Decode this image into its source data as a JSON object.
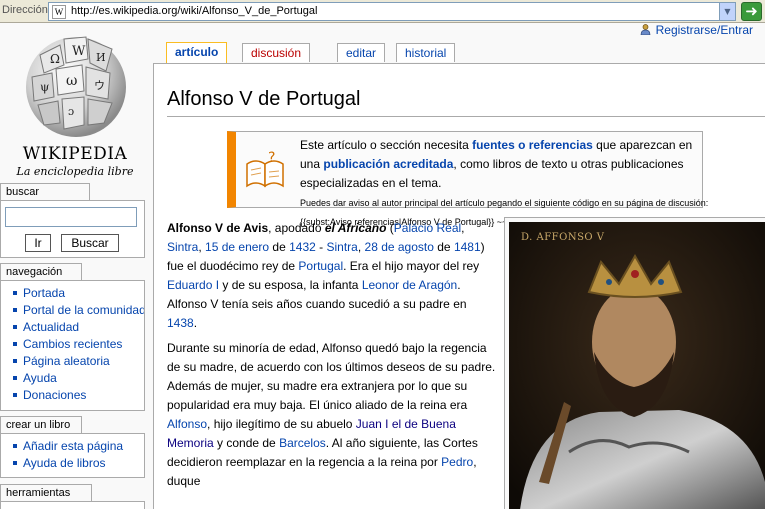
{
  "browser": {
    "address_label": "Dirección",
    "url": "http://es.wikipedia.org/wiki/Alfonso_V_de_Portugal",
    "go_icon": "green-arrow-icon"
  },
  "logo": {
    "wordmark": "WIKIPEDIA",
    "tagline": "La enciclopedia libre"
  },
  "personal": {
    "login": "Registrarse/Entrar"
  },
  "tabs": [
    {
      "label": "artículo"
    },
    {
      "label": "discusión"
    },
    {
      "label": "editar"
    },
    {
      "label": "historial"
    }
  ],
  "search": {
    "title": "buscar",
    "go": "Ir",
    "search": "Buscar"
  },
  "navigation": {
    "title": "navegación",
    "items": [
      "Portada",
      "Portal de la comunidad",
      "Actualidad",
      "Cambios recientes",
      "Página aleatoria",
      "Ayuda",
      "Donaciones"
    ]
  },
  "create_book": {
    "title": "crear un libro",
    "items": [
      "Añadir esta página",
      "Ayuda de libros"
    ]
  },
  "tools": {
    "title": "herramientas"
  },
  "article": {
    "title": "Alfonso V de Portugal",
    "notice": {
      "t1": "Este artículo o sección necesita ",
      "l1": "fuentes o referencias",
      "t2": " que aparezcan en una ",
      "l2": "publicación acreditada",
      "t3": ", como libros de texto u otras publicaciones especializadas en el tema.",
      "small": "Puedes dar aviso al autor principal del artículo pegando el siguiente código en su página de discusión: {{subst:Aviso referencias|Alfonso V de Portugal}} ~~~~"
    },
    "p1": {
      "a": "Alfonso V de Avis",
      "b": ", apodado ",
      "c": "el Africano",
      "d": " (",
      "e": "Palácio Real",
      "f": ", ",
      "g": "Sintra",
      "h": ", ",
      "i": "15 de enero",
      "j": " de ",
      "k": "1432",
      "l": " - ",
      "m": "Sintra",
      "n": ", ",
      "o": "28 de agosto",
      "p": " de ",
      "q": "1481",
      "r": ") fue el duodécimo rey de ",
      "s": "Portugal",
      "t": ". Era el hijo mayor del rey ",
      "u": "Eduardo I",
      "v": " y de su esposa, la infanta ",
      "w": "Leonor de Aragón",
      "x": ". Alfonso V tenía seis años cuando sucedió a su padre en ",
      "y": "1438",
      "z": "."
    },
    "p2": {
      "a": "Durante su minoría de edad, Alfonso quedó bajo la regencia de su madre, de acuerdo con los últimos deseos de su padre. Además de mujer, su madre era extranjera por lo que su popularidad era muy baja. El único aliado de la reina era ",
      "b": "Alfonso",
      "c": ", hijo ilegítimo de su abuelo ",
      "d": "Juan I el de Buena Memoria",
      "e": " y conde de ",
      "f": "Barcelos",
      "g": ". Al año siguiente, las Cortes decidieron reemplazar en la regencia a la reina por ",
      "h": "Pedro",
      "i": ", duque"
    },
    "portrait_label": "D. AFFONSO V"
  }
}
